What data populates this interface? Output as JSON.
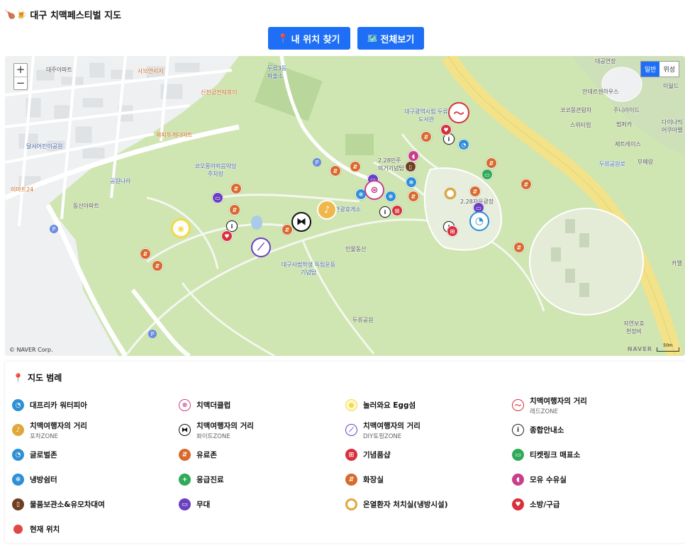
{
  "app": {
    "title": "대구 치맥페스티벌 지도",
    "title_icon": "🍗🍺"
  },
  "toolbar": {
    "locate_label": "내 위치 찾기",
    "locate_icon": "📍",
    "overview_label": "전체보기",
    "overview_icon": "🗺️"
  },
  "map": {
    "zoom_in": "+",
    "zoom_out": "−",
    "type_normal": "일반",
    "type_satellite": "위성",
    "copyright": "© NAVER Corp.",
    "naver": "NAVER",
    "scale": "50m",
    "labels": [
      "대주아파트",
      "사브연리지",
      "신천궁전떡볶이",
      "두류3동 파출소",
      "해피투게더마트",
      "달서어린이공원",
      "코오롱야외음악당 주차장",
      "공원나라",
      "이마트24",
      "동산아파트",
      "대구광역시립 두류도서관",
      "2.28민주 의거기념탑",
      "2.28자유광장",
      "관광휴게소",
      "인물동산",
      "대구사범학생 독립운동기념탑",
      "두류공원",
      "대공연장",
      "이월드",
      "안데르센하우스",
      "코코몽관람차",
      "주니라이드",
      "스위티럽",
      "범퍼카",
      "다이나믹 어쿠아렐",
      "제트레이스",
      "부메랑",
      "두류공원로",
      "자연보호 헌장비",
      "카멜"
    ]
  },
  "legend": {
    "title": "지도 범례",
    "pin_icon": "📍",
    "items": [
      {
        "name": "대프리카 워터피아",
        "sub": "",
        "icon": "water-park-icon",
        "color": "#2d8fd6"
      },
      {
        "name": "치맥더클럽",
        "sub": "",
        "icon": "club-icon",
        "color": "#c8408c"
      },
      {
        "name": "놀러와요 Egg섬",
        "sub": "",
        "icon": "egg-icon",
        "color": "#f2d94a"
      },
      {
        "name": "치맥여행자의 거리",
        "sub": "레드ZONE",
        "icon": "red-zone-icon",
        "color": "#d8303c"
      },
      {
        "name": "치맥여행자의 거리",
        "sub": "포차ZONE",
        "icon": "pocha-zone-icon",
        "color": "#e0a83a"
      },
      {
        "name": "치맥여행자의 거리",
        "sub": "화이트ZONE",
        "icon": "white-zone-icon",
        "color": "#111111"
      },
      {
        "name": "치맥여행자의 거리",
        "sub": "DIY토핑ZONE",
        "icon": "diy-zone-icon",
        "color": "#6a3fc2"
      },
      {
        "name": "종합안내소",
        "sub": "",
        "icon": "info-icon",
        "color": "#222222"
      },
      {
        "name": "글로벌존",
        "sub": "",
        "icon": "global-zone-icon",
        "color": "#2d8fd6"
      },
      {
        "name": "유료존",
        "sub": "",
        "icon": "paid-zone-icon",
        "color": "#d86a2c"
      },
      {
        "name": "기념품샵",
        "sub": "",
        "icon": "gift-shop-icon",
        "color": "#d8303c"
      },
      {
        "name": "티켓링크 매표소",
        "sub": "",
        "icon": "ticket-icon",
        "color": "#2faa58"
      },
      {
        "name": "냉방쉼터",
        "sub": "",
        "icon": "cooling-shelter-icon",
        "color": "#2d8fd6"
      },
      {
        "name": "응급진료",
        "sub": "",
        "icon": "first-aid-icon",
        "color": "#2faa58"
      },
      {
        "name": "화장실",
        "sub": "",
        "icon": "restroom-icon",
        "color": "#d86a2c"
      },
      {
        "name": "모유 수유실",
        "sub": "",
        "icon": "nursing-room-icon",
        "color": "#c8408c"
      },
      {
        "name": "물품보관소&유모차대여",
        "sub": "",
        "icon": "locker-icon",
        "color": "#6e4020"
      },
      {
        "name": "무대",
        "sub": "",
        "icon": "stage-icon",
        "color": "#6a3fc2"
      },
      {
        "name": "온열환자 처치실(냉방시설)",
        "sub": "",
        "icon": "heat-care-icon",
        "color": "#e0a83a"
      },
      {
        "name": "소방/구급",
        "sub": "",
        "icon": "fire-rescue-icon",
        "color": "#d8303c"
      },
      {
        "name": "현재 위치",
        "sub": "",
        "icon": "current-location-icon",
        "color": "#e04848"
      }
    ]
  }
}
